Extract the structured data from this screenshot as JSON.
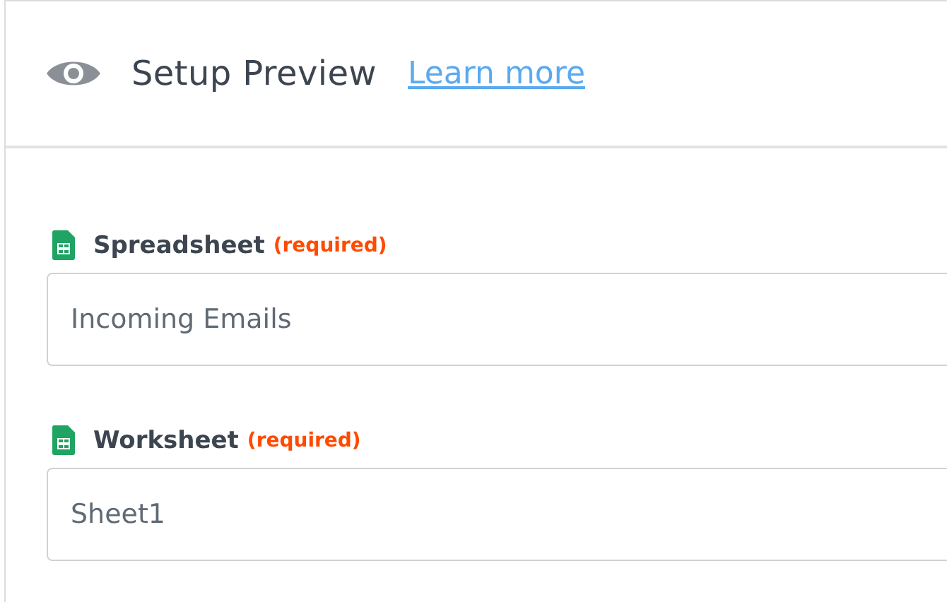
{
  "header": {
    "title": "Setup Preview",
    "link": "Learn more"
  },
  "fields": [
    {
      "label": "Spreadsheet",
      "required": "(required)",
      "value": "Incoming Emails"
    },
    {
      "label": "Worksheet",
      "required": "(required)",
      "value": "Sheet1"
    }
  ]
}
